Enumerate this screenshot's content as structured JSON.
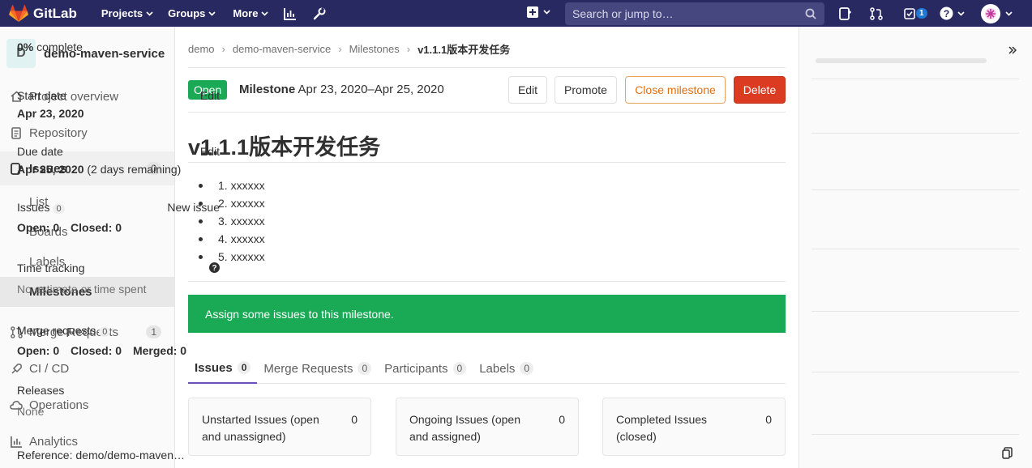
{
  "topnav": {
    "brand": "GitLab",
    "projects": "Projects",
    "groups": "Groups",
    "more": "More",
    "search_placeholder": "Search or jump to…",
    "todos_count": "1"
  },
  "sidebar": {
    "project_initial": "D",
    "project_name": "demo-maven-service",
    "items": [
      {
        "label": "Project overview"
      },
      {
        "label": "Repository"
      },
      {
        "label": "Issues",
        "count": "0"
      },
      {
        "label": "Merge Requests",
        "count": "1"
      },
      {
        "label": "CI / CD"
      },
      {
        "label": "Operations"
      },
      {
        "label": "Analytics"
      }
    ],
    "issue_sub": [
      "List",
      "Boards",
      "Labels",
      "Milestones"
    ]
  },
  "breadcrumbs": [
    "demo",
    "demo-maven-service",
    "Milestones",
    "v1.1.1版本开发任务"
  ],
  "milestone": {
    "status": "Open",
    "label": "Milestone",
    "dates": "Apr 23, 2020–Apr 25, 2020",
    "title": "v1.1.1版本开发任务",
    "description": [
      "1. xxxxxx",
      "2. xxxxxx",
      "3. xxxxxx",
      "4. xxxxxx",
      "5. xxxxxx"
    ],
    "alert": "Assign some issues to this milestone."
  },
  "actions": {
    "edit": "Edit",
    "promote": "Promote",
    "close": "Close milestone",
    "delete": "Delete"
  },
  "tabs": [
    {
      "label": "Issues",
      "count": "0"
    },
    {
      "label": "Merge Requests",
      "count": "0"
    },
    {
      "label": "Participants",
      "count": "0"
    },
    {
      "label": "Labels",
      "count": "0"
    }
  ],
  "boards": [
    {
      "line1": "Unstarted Issues (open",
      "line2": "and unassigned)",
      "count": "0"
    },
    {
      "line1": "Ongoing Issues (open",
      "line2": "and assigned)",
      "count": "0"
    },
    {
      "line1": "Completed Issues",
      "line2": "(closed)",
      "count": "0"
    }
  ],
  "right": {
    "percent": "0%",
    "complete": "complete",
    "progress": 0,
    "start_label": "Start date",
    "start_date": "Apr 23, 2020",
    "edit": "Edit",
    "due_label": "Due date",
    "due_date": "Apr 25, 2020",
    "due_remaining": "(2 days remaining)",
    "issues_label": "Issues",
    "issues_count": "0",
    "new_issue": "New issue",
    "open_label": "Open:",
    "open_val": "0",
    "closed_label": "Closed:",
    "closed_val": "0",
    "time_label": "Time tracking",
    "time_value": "No estimate or time spent",
    "mr_label": "Merge requests",
    "mr_count": "0",
    "merged_label": "Merged:",
    "merged_val": "0",
    "releases_label": "Releases",
    "releases_value": "None",
    "reference": "Reference: demo/demo-maven…"
  },
  "colors": {
    "nav": "#292961",
    "success": "#1aaa55",
    "danger": "#db3b21",
    "warning": "#e07010"
  }
}
